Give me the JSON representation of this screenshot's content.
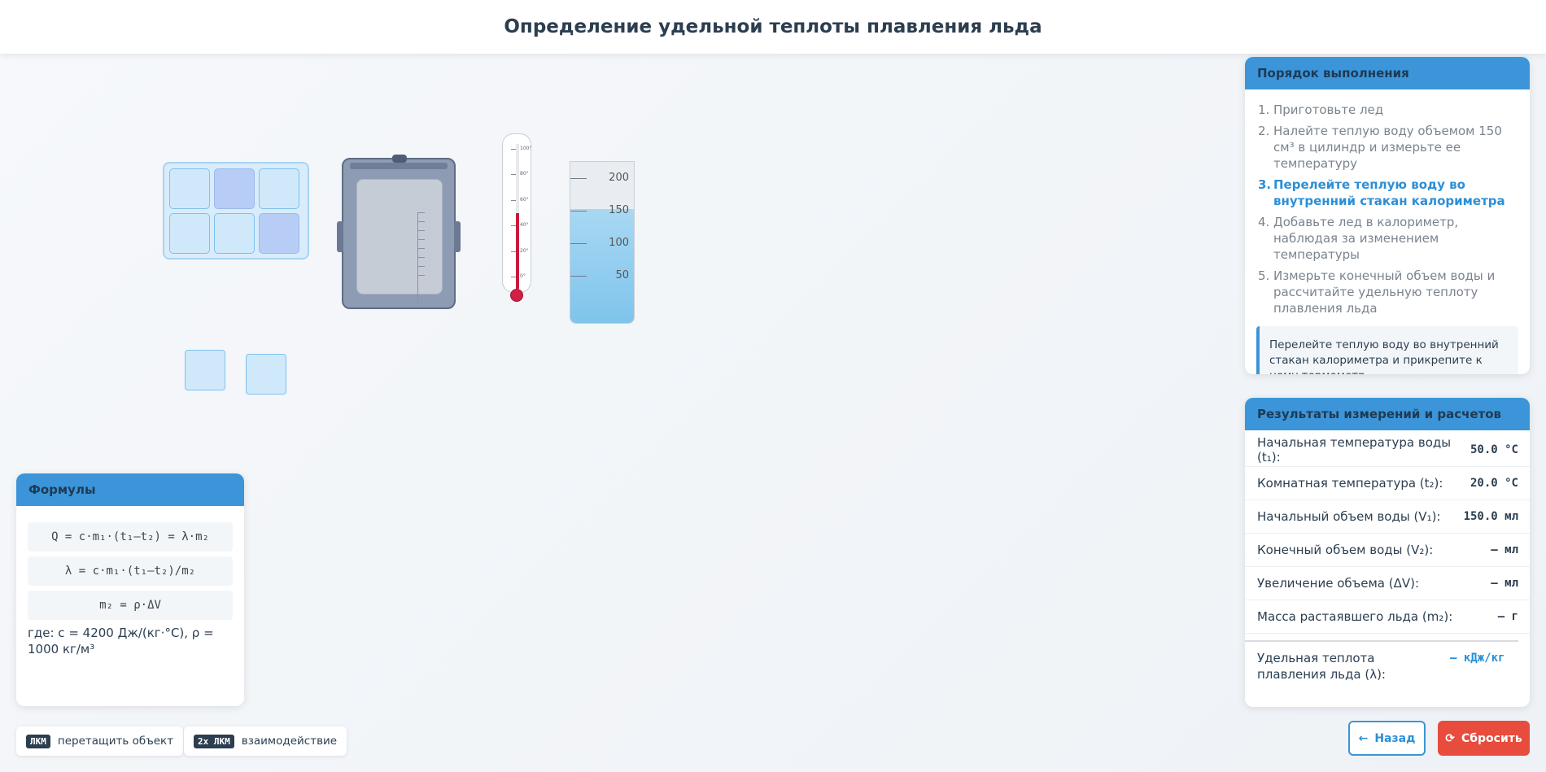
{
  "app": {
    "title": "Определение удельной теплоты плавления льда"
  },
  "instructions": {
    "title": "Порядок выполнения",
    "steps": [
      {
        "num": "1.",
        "text": "Приготовьте лед"
      },
      {
        "num": "2.",
        "text": "Налейте теплую воду объемом 150 см³ в цилиндр и измерьте ее температуру"
      },
      {
        "num": "3.",
        "text": "Перелейте теплую воду во внутренний стакан калориметра"
      },
      {
        "num": "4.",
        "text": "Добавьте лед в калориметр, наблюдая за изменением температуры"
      },
      {
        "num": "5.",
        "text": "Измерьте конечный объем воды и рассчитайте удельную теплоту плавления льда"
      }
    ],
    "active_step": 3,
    "hint": "Перелейте теплую воду во внутренний стакан калориметра и прикрепите к нему термометр."
  },
  "results": {
    "title": "Результаты измерений и расчетов",
    "rows": [
      {
        "label": "Начальная температура воды (t₁):",
        "value": "50.0 °C"
      },
      {
        "label": "Комнатная температура (t₂):",
        "value": "20.0 °C"
      },
      {
        "label": "Начальный объем воды (V₁):",
        "value": "150.0 мл"
      },
      {
        "label": "Конечный объем воды (V₂):",
        "value": "– мл"
      },
      {
        "label": "Увеличение объема (ΔV):",
        "value": "– мл"
      },
      {
        "label": "Масса растаявшего льда (m₂):",
        "value": "– г"
      }
    ],
    "final": {
      "label": "Удельная теплота плавления льда (λ):",
      "value": "– кДж/кг"
    }
  },
  "formulas": {
    "title": "Формулы",
    "items": [
      "Q = c·m₁·(t₁–t₂) = λ·m₂",
      "λ = c·m₁·(t₁–t₂)/m₂",
      "m₂ = ρ·ΔV"
    ],
    "note": "где: c = 4200 Дж/(кг·°C), ρ = 1000 кг/м³"
  },
  "legend": [
    {
      "key": "ЛКМ",
      "text": "перетащить объект"
    },
    {
      "key": "2x ЛКМ",
      "text": "взаимодействие"
    }
  ],
  "buttons": {
    "back": "Назад",
    "reset": "Сбросить"
  },
  "equipment": {
    "thermometer_labels": [
      "100°",
      "80°",
      "60°",
      "40°",
      "20°",
      "0°"
    ],
    "thermometer_level_celsius": 50,
    "cylinder_labels": [
      "200",
      "150",
      "100",
      "50"
    ],
    "cylinder_volume_ml": 150,
    "close_glyph": "×"
  },
  "colors": {
    "accent": "#3b95d8",
    "danger": "#e74c3c",
    "mercury": "#c91a3d",
    "water": "#8ccbee"
  }
}
